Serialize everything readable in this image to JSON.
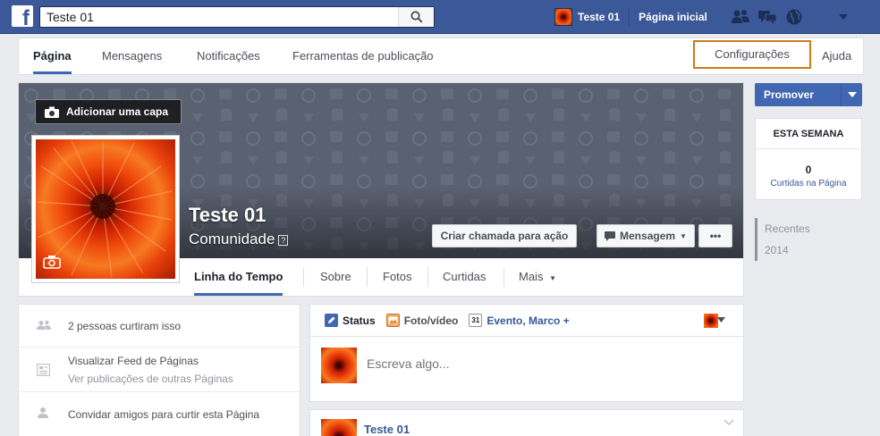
{
  "topbar": {
    "logo": "f",
    "search_value": "Teste 01",
    "search_icon": "search-icon",
    "profile_name": "Teste 01",
    "home_label": "Página inicial",
    "icons": [
      "friends-icon",
      "messages-icon",
      "globe-icon"
    ],
    "menu_icon": "caret-down-icon",
    "bg_color": "#3b5998"
  },
  "pagenav": {
    "tabs": [
      {
        "label": "Página",
        "active": true
      },
      {
        "label": "Mensagens"
      },
      {
        "label": "Notificações"
      },
      {
        "label": "Ferramentas de publicação"
      }
    ],
    "settings_label": "Configurações",
    "help_label": "Ajuda",
    "highlight_color": "#d07a1a"
  },
  "cover": {
    "add_cover_label": "Adicionar uma capa",
    "page_name": "Teste 01",
    "category": "Comunidade",
    "category_help": "?",
    "cta_label": "Criar chamada para ação",
    "message_label": "Mensagem",
    "more_label": "•••"
  },
  "subtabs": {
    "items": [
      {
        "label": "Linha do Tempo",
        "active": true
      },
      {
        "label": "Sobre"
      },
      {
        "label": "Fotos"
      },
      {
        "label": "Curtidas"
      },
      {
        "label": "Mais"
      }
    ]
  },
  "right": {
    "promote_label": "Promover",
    "week_title": "ESTA SEMANA",
    "week_count": "0",
    "week_label": "Curtidas na Página",
    "years": [
      "Recentes",
      "2014"
    ],
    "accent_color": "#4267b2"
  },
  "left": {
    "likes_text": "2 pessoas curtiram isso",
    "feed_title": "Visualizar Feed de Páginas",
    "feed_sub": "Ver publicações de outras Páginas",
    "invite_text": "Convidar amigos para curtir esta Página"
  },
  "composer": {
    "tabs": [
      {
        "label": "Status",
        "icon": "pencil-icon"
      },
      {
        "label": "Foto/vídeo",
        "icon": "photo-icon"
      },
      {
        "label": "Evento, Marco +",
        "icon": "calendar-icon",
        "icon_text": "31"
      }
    ],
    "placeholder": "Escreva algo..."
  },
  "post": {
    "name": "Teste 01"
  }
}
